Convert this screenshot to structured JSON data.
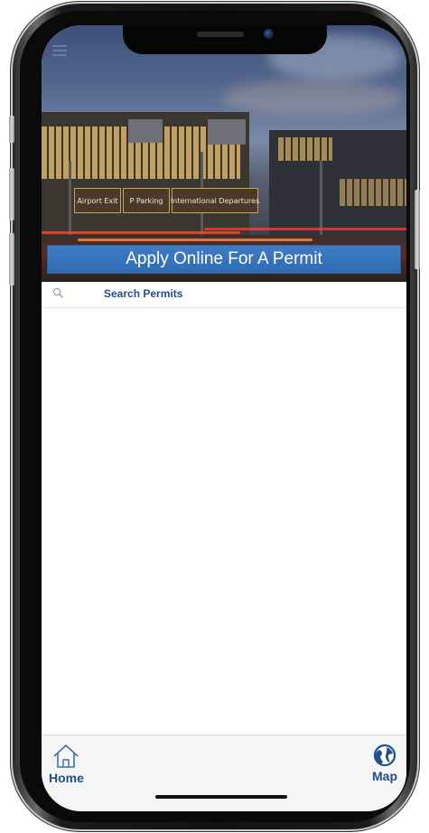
{
  "header": {
    "banner_label": "Apply Online For A Permit"
  },
  "hero_signs": {
    "sign1": "Airport Exit",
    "sign2": "P  Parking",
    "sign3": "International Departures"
  },
  "search": {
    "label": "Search Permits"
  },
  "tabbar": {
    "home_label": "Home",
    "map_label": "Map"
  },
  "icons": {
    "menu": "hamburger-menu-icon",
    "search": "search-icon",
    "home": "home-icon",
    "map": "globe-icon"
  },
  "colors": {
    "accent": "#1f4f8c",
    "banner": "#2f6bb3"
  }
}
